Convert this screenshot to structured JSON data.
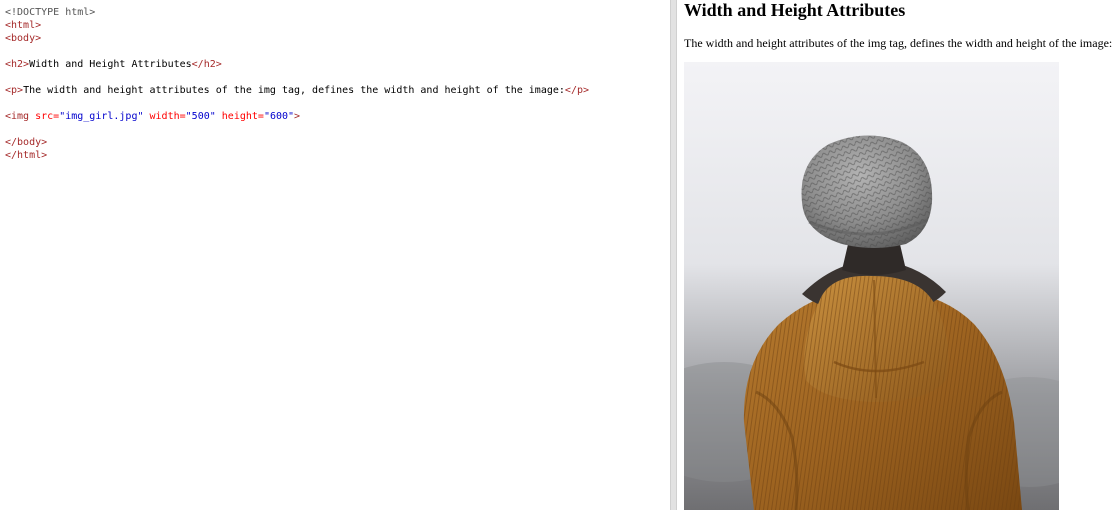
{
  "editor": {
    "lines": [
      [
        {
          "t": "<!DOCTYPE html>",
          "c": "doctype"
        }
      ],
      [
        {
          "t": "<html>",
          "c": "tag"
        }
      ],
      [
        {
          "t": "<body>",
          "c": "tag"
        }
      ],
      [
        {
          "t": "",
          "c": "text"
        }
      ],
      [
        {
          "t": "<h2>",
          "c": "tag"
        },
        {
          "t": "Width and Height Attributes",
          "c": "text"
        },
        {
          "t": "</h2>",
          "c": "tag"
        }
      ],
      [
        {
          "t": "",
          "c": "text"
        }
      ],
      [
        {
          "t": "<p>",
          "c": "tag"
        },
        {
          "t": "The width and height attributes of the img tag, defines the width and height of the image:",
          "c": "text"
        },
        {
          "t": "</p>",
          "c": "tag"
        }
      ],
      [
        {
          "t": "",
          "c": "text"
        }
      ],
      [
        {
          "t": "<img",
          "c": "tag"
        },
        {
          "t": " src=",
          "c": "attr"
        },
        {
          "t": "\"img_girl.jpg\"",
          "c": "val"
        },
        {
          "t": " width=",
          "c": "attr"
        },
        {
          "t": "\"500\"",
          "c": "val"
        },
        {
          "t": " height=",
          "c": "attr"
        },
        {
          "t": "\"600\"",
          "c": "val"
        },
        {
          "t": ">",
          "c": "tag"
        }
      ],
      [
        {
          "t": "",
          "c": "text"
        }
      ],
      [
        {
          "t": "</body>",
          "c": "tag"
        }
      ],
      [
        {
          "t": "</html>",
          "c": "tag"
        }
      ]
    ]
  },
  "preview": {
    "heading": "Width and Height Attributes",
    "paragraph": "The width and height attributes of the img tag, defines the width and height of the image:",
    "image_icon": "photo-of-person-in-beanie-and-jacket"
  },
  "colors": {
    "doctype": "#555555",
    "tag": "#a52a2a",
    "attr": "#ff0000",
    "val": "#0000cd",
    "divider": "#e2e2e2"
  }
}
